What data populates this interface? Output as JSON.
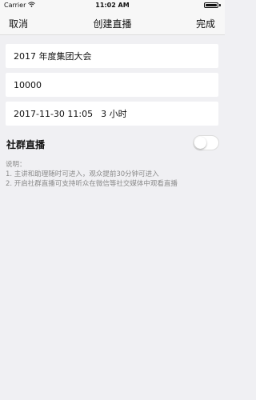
{
  "status_bar": {
    "carrier": "Carrier",
    "time": "11:02 AM"
  },
  "nav": {
    "cancel_label": "取消",
    "title": "创建直播",
    "done_label": "完成"
  },
  "form": {
    "name_value": "2017 年度集团大会",
    "number_value": "10000",
    "datetime_value": "2017-11-30 11:05",
    "duration_value": "3 小时"
  },
  "community_live": {
    "label": "社群直播",
    "enabled": false
  },
  "notes": {
    "title": "说明：",
    "line1": "1. 主讲和助理随时可进入，观众提前30分钟可进入",
    "line2": "2. 开启社群直播可支持听众在微信等社交媒体中观看直播"
  }
}
